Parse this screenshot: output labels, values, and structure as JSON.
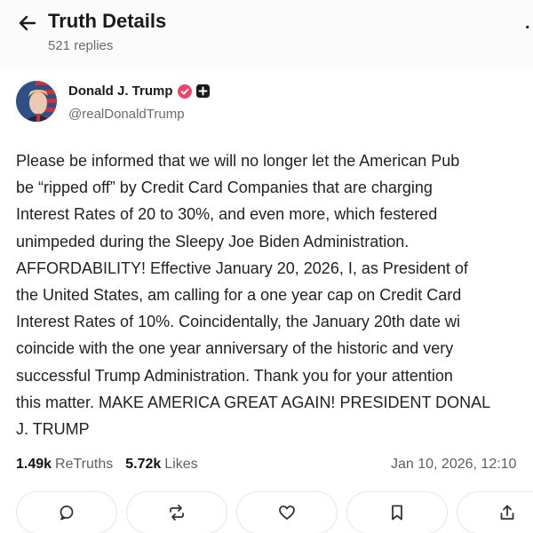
{
  "header": {
    "title": "Truth Details",
    "replies": "521 replies",
    "back_icon": "arrow-left-icon",
    "more_icon": "more-icon"
  },
  "author": {
    "name": "Donald J. Trump",
    "handle": "@realDonaldTrump",
    "verified_color": "#e8476b"
  },
  "post": {
    "lines": [
      "Please be informed that we will no longer let the American Pub",
      "be “ripped off” by Credit Card Companies that are charging",
      "Interest Rates of 20 to 30%, and even more, which festered",
      "unimpeded during the Sleepy Joe Biden Administration.",
      "AFFORDABILITY! Effective January 20, 2026, I, as President of",
      "the United States, am calling for a one year cap on Credit Card",
      "Interest Rates of 10%. Coincidentally, the January 20th date wi",
      "coincide with the one year anniversary of the historic and very",
      "successful Trump Administration. Thank you for your attention",
      "this matter. MAKE AMERICA GREAT AGAIN! PRESIDENT DONAL",
      "J. TRUMP"
    ]
  },
  "stats": {
    "retruths_count": "1.49k",
    "retruths_label": "ReTruths",
    "likes_count": "5.72k",
    "likes_label": "Likes",
    "timestamp": "Jan 10, 2026, 12:10"
  },
  "actions": [
    {
      "icon": "reply-icon"
    },
    {
      "icon": "retruth-icon"
    },
    {
      "icon": "like-icon"
    },
    {
      "icon": "bookmark-icon"
    },
    {
      "icon": "share-icon"
    }
  ]
}
